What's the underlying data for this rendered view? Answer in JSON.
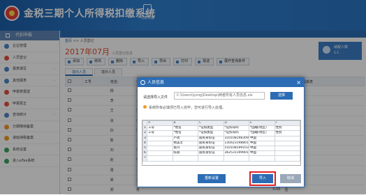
{
  "app": {
    "title": "金税三期个人所得税扣缴系统",
    "tool_label": "代扣代缴"
  },
  "sidebar": {
    "header": "代扣申报",
    "items": [
      {
        "label": "企业管理",
        "color": "blue",
        "arrow": ""
      },
      {
        "label": "人员登记",
        "color": "red",
        "arrow": ""
      },
      {
        "label": "报表填写",
        "color": "blue",
        "arrow": "›"
      },
      {
        "label": "其他报表",
        "color": "blue",
        "arrow": "›"
      },
      {
        "label": "申报表报送",
        "color": "red",
        "arrow": ""
      },
      {
        "label": "申报更正",
        "color": "red",
        "arrow": ""
      },
      {
        "label": "查询统计",
        "color": "blue",
        "arrow": "›"
      },
      {
        "label": "分期缴纳备案",
        "color": "orange",
        "arrow": ""
      },
      {
        "label": "递延纳税备案",
        "color": "orange",
        "arrow": ""
      },
      {
        "label": "系统设置",
        "color": "green",
        "arrow": ""
      },
      {
        "label": "进入eTax系统",
        "color": "green",
        "arrow": ""
      }
    ]
  },
  "breadcrumb": {
    "home": "首页",
    "current": "人员登记"
  },
  "period": {
    "label": "2017年07月",
    "sub": "人员登记信息"
  },
  "user": {
    "line1": "纳税人数",
    "line2": "1人"
  },
  "toolbar": [
    "添加",
    "修改",
    "删除",
    "导入",
    "导出",
    "打印",
    "报送",
    "展开查询条件"
  ],
  "tabs": [
    "境内人员",
    "境外人员"
  ],
  "grid": {
    "headers": [
      "工号",
      "姓名",
      "性别",
      "",
      "",
      "",
      "",
      "",
      "",
      "",
      "",
      "减除（税收）",
      "是否残疾烈属孤老"
    ],
    "rows": [
      {
        "name": "杨",
        "sex": "女",
        "val": "0.00",
        "flag": "否"
      },
      {
        "name": "李",
        "sex": "女",
        "val": "0.00",
        "flag": "否"
      },
      {
        "name": "王",
        "sex": "男",
        "val": "0.00",
        "flag": "否"
      },
      {
        "name": "张",
        "sex": "男",
        "val": "0.00",
        "flag": "否"
      },
      {
        "name": "孙",
        "sex": "男",
        "val": "0.00",
        "flag": "否"
      },
      {
        "name": "陈",
        "sex": "女",
        "val": "0.00",
        "flag": "否"
      },
      {
        "name": "刘",
        "sex": "男",
        "val": "0.00",
        "flag": "否"
      },
      {
        "name": "赵",
        "sex": "男",
        "val": "0.00",
        "flag": "否"
      },
      {
        "name": "周",
        "sex": "女",
        "val": "0.00",
        "flag": "否"
      },
      {
        "name": "吴",
        "sex": "女",
        "val": "0.00",
        "flag": "否"
      },
      {
        "name": "郑",
        "sex": "男",
        "val": "0.00",
        "flag": "否"
      }
    ]
  },
  "dialog": {
    "title": "人员信息",
    "file_label": "请选择导入文件",
    "file_path": "C:\\Users\\lyzrqj\\Desktop\\两者所有人员信息.xls",
    "choose_label": "选择",
    "tip": "系统所有必填项已导入完毕，您可进行导入处理。",
    "sheet_cols": [
      "",
      "A",
      "B",
      "C",
      "D",
      "E",
      "F"
    ],
    "sheet_rows": [
      [
        "1",
        "工号",
        "*姓名",
        "*证照类型",
        "*证照号码",
        "*国籍(地区)",
        "性别"
      ],
      [
        "2",
        "工号",
        "*姓名",
        "*证照类型",
        "*证照号码",
        "*国籍(地区)",
        "性别"
      ],
      [
        "3",
        "",
        "卢荷",
        "居民身份证",
        "310108198309",
        "中国",
        ""
      ],
      [
        "4",
        "",
        "杨美丰",
        "居民身份证",
        "130423198801",
        "中国",
        ""
      ],
      [
        "5",
        "",
        "张兴",
        "居民身份证",
        "510108199103",
        "中国",
        ""
      ],
      [
        "6",
        "",
        "陈丽",
        "居民身份证",
        "362531199901",
        "中国",
        ""
      ],
      [
        "7",
        "",
        "",
        "",
        "",
        "",
        ""
      ]
    ],
    "reset_label": "重新设置",
    "import_label": "导入",
    "cancel_label": "取消"
  }
}
